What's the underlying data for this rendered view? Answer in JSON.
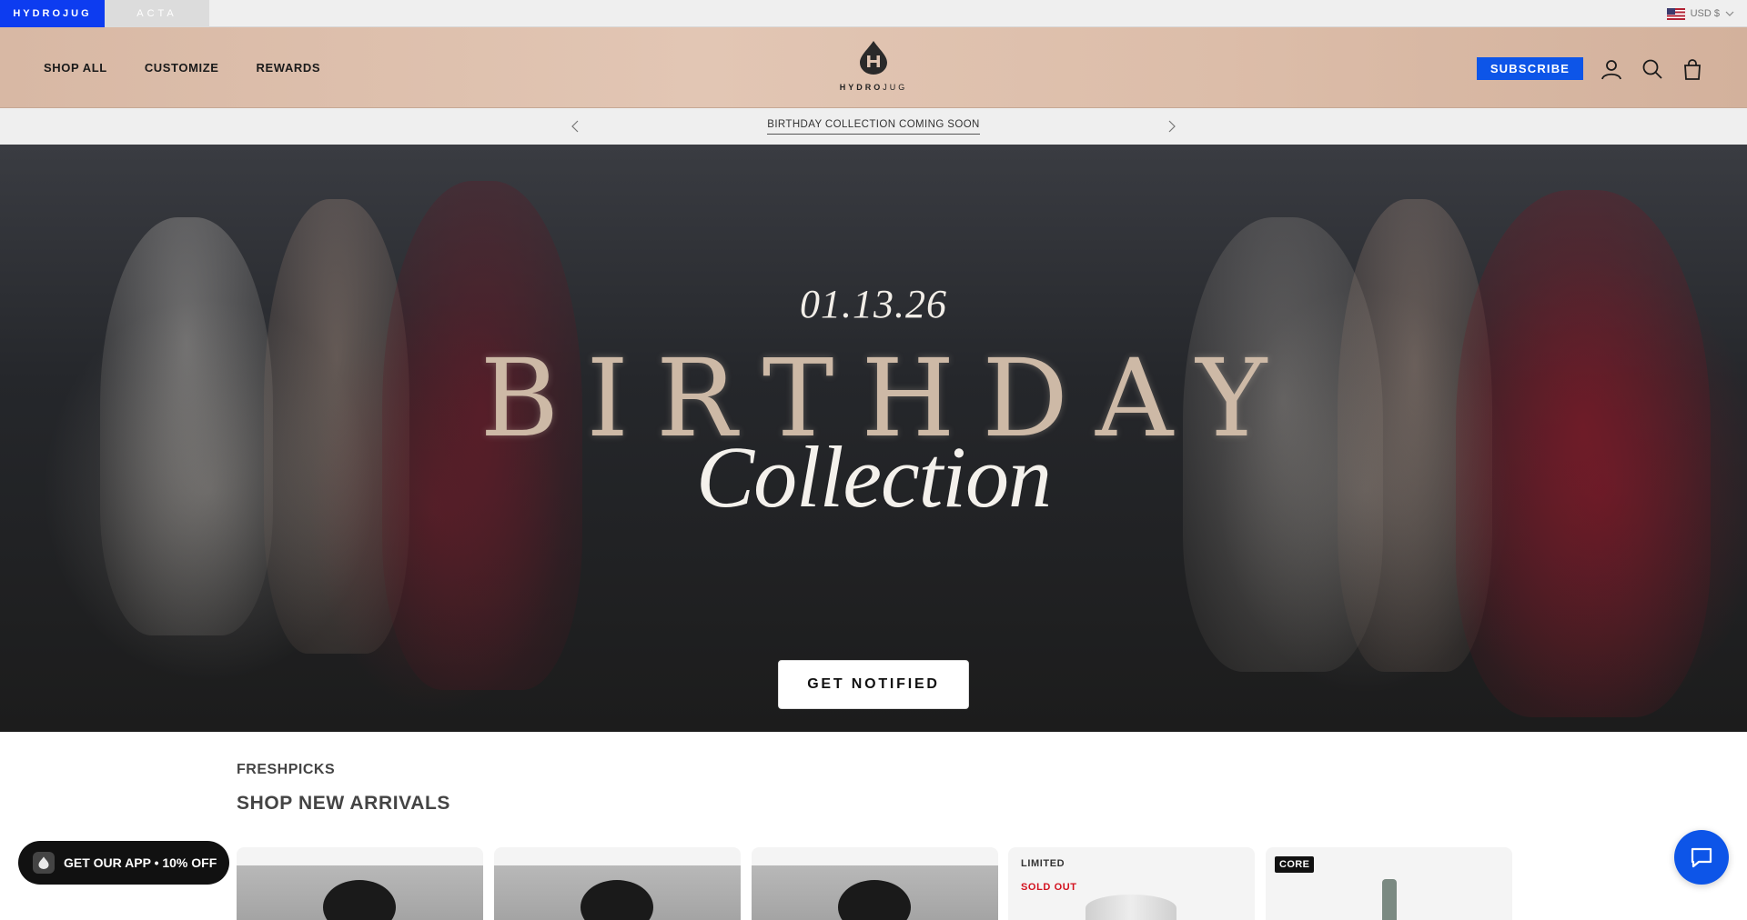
{
  "brand_bar": {
    "tabs": [
      {
        "label": "HYDROJUG",
        "active": true
      },
      {
        "label": "ACTA",
        "active": false
      }
    ],
    "currency": "USD $"
  },
  "header": {
    "nav": [
      "SHOP ALL",
      "CUSTOMIZE",
      "REWARDS"
    ],
    "logo_text_bold": "HYDRO",
    "logo_text_light": "JUG",
    "subscribe_label": "SUBSCRIBE",
    "icons": [
      "account-icon",
      "search-icon",
      "bag-icon"
    ]
  },
  "announcement": {
    "text": "BIRTHDAY COLLECTION COMING SOON"
  },
  "hero": {
    "date": "01.13.26",
    "title": "BIRTHDAY",
    "subtitle": "Collection",
    "cta": "GET NOTIFIED"
  },
  "products": {
    "eyebrow": "FRESHPICKS",
    "title": "SHOP NEW ARRIVALS",
    "cards": [
      {
        "badge": ""
      },
      {
        "badge": ""
      },
      {
        "badge": ""
      },
      {
        "badge": "LIMITED",
        "status": "SOLD OUT"
      },
      {
        "badge": "CORE"
      }
    ]
  },
  "app_promo": {
    "label": "GET OUR APP • 10% OFF"
  },
  "colors": {
    "accent": "#0d55e8",
    "brand_tab": "#0d3cf0",
    "sold_out": "#d3121f"
  }
}
